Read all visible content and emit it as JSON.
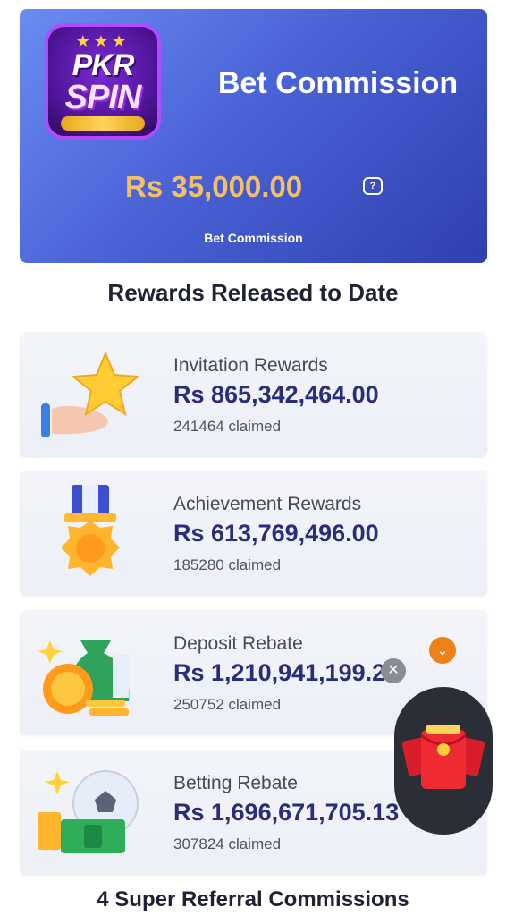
{
  "banner": {
    "logo_top": "PKR",
    "logo_bottom": "SPIN",
    "title": "Bet Commission",
    "amount": "Rs 35,000.00",
    "help_glyph": "?",
    "subtitle": "Bet Commission"
  },
  "rewards_title": "Rewards Released to Date",
  "rewards": [
    {
      "label": "Invitation Rewards",
      "amount": "Rs 865,342,464.00",
      "claimed": "241464 claimed",
      "icon": "star-hand-icon"
    },
    {
      "label": "Achievement Rewards",
      "amount": "Rs 613,769,496.00",
      "claimed": "185280 claimed",
      "icon": "medal-icon"
    },
    {
      "label": "Deposit Rebate",
      "amount": "Rs 1,210,941,199.20",
      "claimed": "250752 claimed",
      "icon": "money-bag-icon"
    },
    {
      "label": "Betting Rebate",
      "amount": "Rs 1,696,671,705.13",
      "claimed": "307824 claimed",
      "icon": "ball-cash-icon"
    }
  ],
  "overlay": {
    "chevron_glyph": "⌄",
    "close_glyph": "✕",
    "float_icon": "red-envelope-icon"
  },
  "footer_title": "4 Super Referral Commissions",
  "colors": {
    "banner_start": "#6a8cf0",
    "banner_end": "#2f3fb0",
    "amount_gold": "#f5bf67",
    "amount_navy": "#2a2d7a",
    "accent_orange": "#f08018"
  }
}
